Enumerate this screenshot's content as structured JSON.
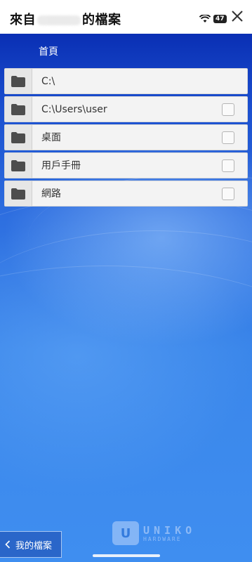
{
  "header": {
    "title_prefix": "來自",
    "title_suffix": "的檔案",
    "battery": "47"
  },
  "breadcrumb": {
    "home": "首頁"
  },
  "rows": [
    {
      "label": "C:\\",
      "has_checkbox": false
    },
    {
      "label": "C:\\Users\\user",
      "has_checkbox": true
    },
    {
      "label": "桌面",
      "has_checkbox": true
    },
    {
      "label": "用戶手冊",
      "has_checkbox": true
    },
    {
      "label": "網路",
      "has_checkbox": true
    }
  ],
  "footer": {
    "my_files": "我的檔案"
  },
  "watermark": {
    "logo_letter": "U",
    "brand": "UNIKO",
    "sub": "HARDWARE"
  },
  "icons": {
    "folder": "folder-icon",
    "close": "close-icon",
    "wifi": "wifi-icon",
    "back": "chevron-left-icon"
  },
  "colors": {
    "accent": "#2a66c9",
    "background_top": "#0a2fb4",
    "background_bottom": "#3f8ef0"
  }
}
